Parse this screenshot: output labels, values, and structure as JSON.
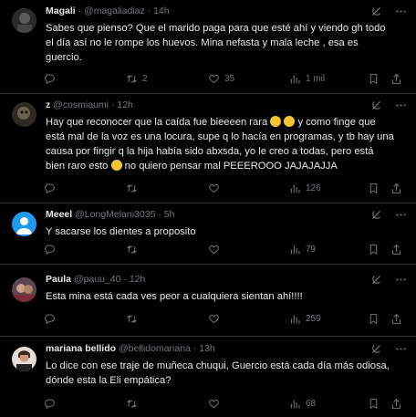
{
  "tweets": [
    {
      "name": "Magali",
      "verified_dot": "·",
      "handle": "@magaliadiaz",
      "time": "14h",
      "lines": [
        "Sabes que pienso? Que el marido paga para que esté ahí y viendo gh todo",
        "el día así no le rompe los huevos. Mina nefasta y mala leche , esa es",
        "guercio."
      ],
      "reply": "",
      "retweet": "2",
      "like": "35",
      "views": "1 mil",
      "avatar_color": "#3a3a3a"
    },
    {
      "name": "z",
      "handle": "@cosmiaumi",
      "time": "12h",
      "lines": [
        "Hay que reconocer que la caída fue bieeeen rara",
        "y como finge que",
        "está mal de la voz es una locura, supe q lo hacía en programas, y tb hay una",
        "causa por fingir q la hija había sido abxsda, yo le creo a todas, pero está",
        "bien raro esto",
        "no quiero pensar mal PEEEROOO JAJAJAJJA"
      ],
      "reply": "",
      "retweet": "",
      "like": "",
      "views": "126",
      "avatar_color": "#4a4a40"
    },
    {
      "name": "Meeel",
      "handle": "@LongMelani3035",
      "time": "5h",
      "lines": [
        "Y sacarse los dientes a proposito"
      ],
      "reply": "",
      "retweet": "",
      "like": "",
      "views": "79",
      "avatar_color": "#1d9bf0"
    },
    {
      "name": "Paula",
      "handle": "@pauu_40",
      "time": "12h",
      "lines": [
        "Esta mina está cada ves peor a cualquiera sientan ahí!!!!"
      ],
      "reply": "",
      "retweet": "",
      "like": "",
      "views": "259",
      "avatar_color": "#6b4f5a"
    },
    {
      "name": "mariana bellido",
      "handle": "@bellidomariana",
      "time": "13h",
      "lines": [
        "Lo dice con ese traje de muñeca chuqui, Guercio está cada día más odiosa,",
        "dónde esta la Eli empática?"
      ],
      "reply": "",
      "retweet": "",
      "like": "",
      "views": "68",
      "avatar_color": "#d8c8c0"
    }
  ]
}
